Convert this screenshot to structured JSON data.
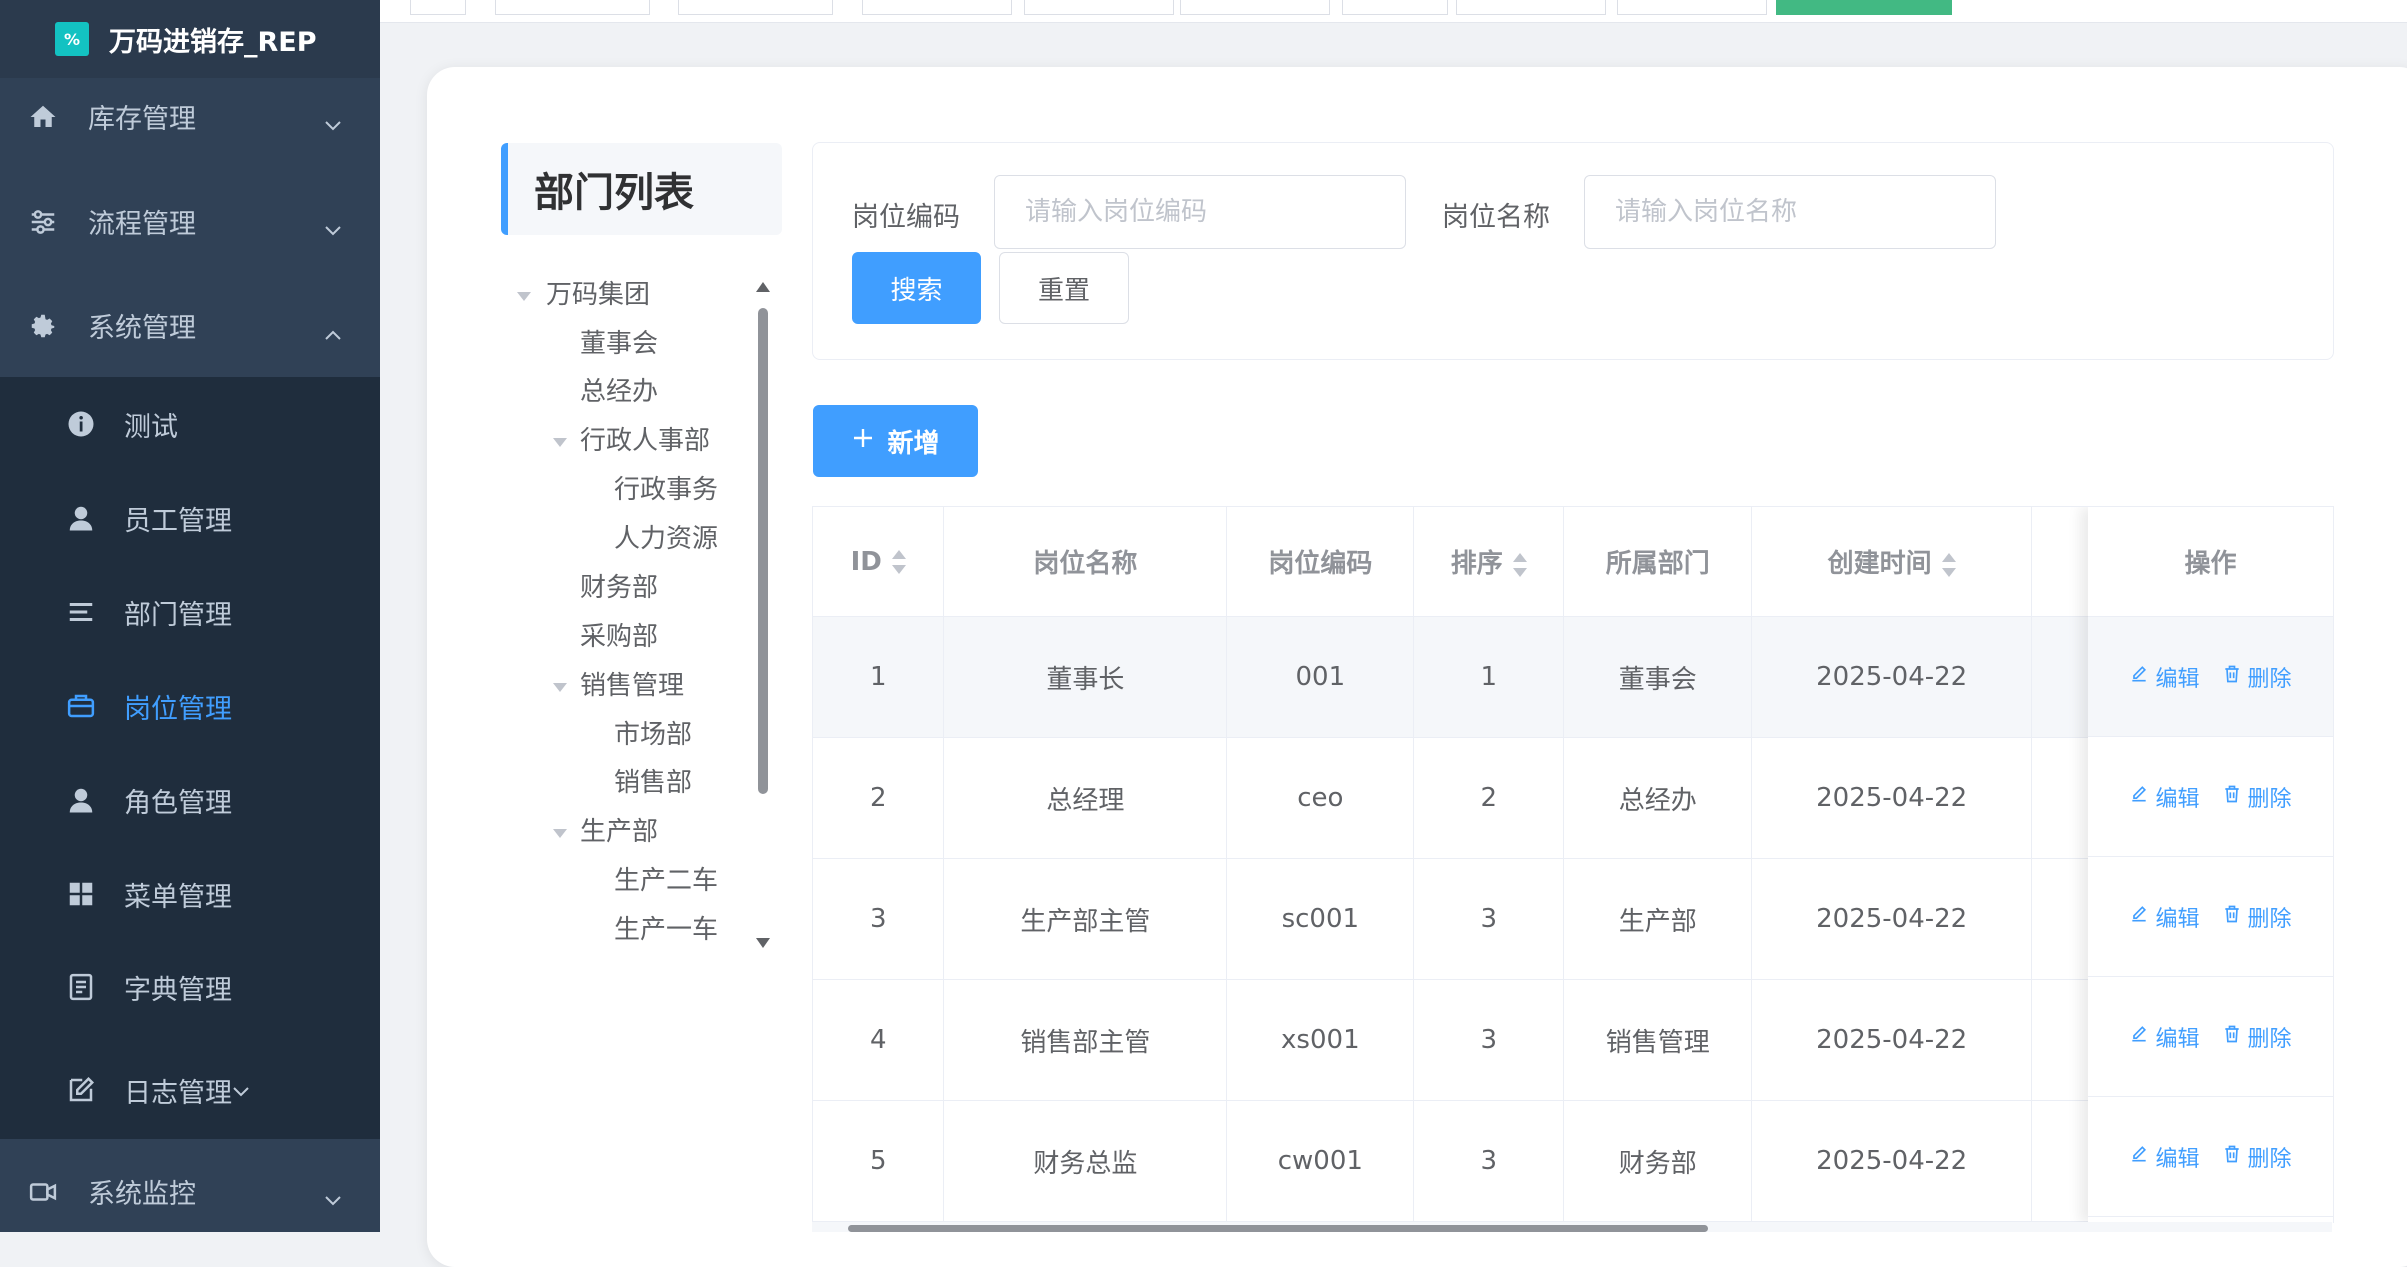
{
  "app": {
    "logo_text": "%",
    "title": "万码进销存_REP"
  },
  "sidebar": {
    "top_menus": [
      {
        "label": "库存管理",
        "icon": "home-icon",
        "expanded": false
      },
      {
        "label": "流程管理",
        "icon": "sliders-icon",
        "expanded": false
      },
      {
        "label": "系统管理",
        "icon": "gear-icon",
        "expanded": true
      }
    ],
    "sub_items": [
      {
        "label": "测试",
        "icon": "info-icon"
      },
      {
        "label": "员工管理",
        "icon": "user-icon"
      },
      {
        "label": "部门管理",
        "icon": "list-icon"
      },
      {
        "label": "岗位管理",
        "icon": "briefcase-icon",
        "active": true
      },
      {
        "label": "角色管理",
        "icon": "user-icon"
      },
      {
        "label": "菜单管理",
        "icon": "grid-icon"
      },
      {
        "label": "字典管理",
        "icon": "document-icon"
      },
      {
        "label": "日志管理",
        "icon": "edit-icon"
      }
    ],
    "bottom_menu": {
      "label": "系统监控",
      "icon": "video-icon"
    }
  },
  "dept_panel": {
    "title": "部门列表",
    "tree": [
      {
        "label": "万码集团",
        "level": 0,
        "expandable": true
      },
      {
        "label": "董事会",
        "level": 1
      },
      {
        "label": "总经办",
        "level": 1
      },
      {
        "label": "行政人事部",
        "level": 1,
        "expandable": true
      },
      {
        "label": "行政事务",
        "level": 2
      },
      {
        "label": "人力资源",
        "level": 2
      },
      {
        "label": "财务部",
        "level": 1
      },
      {
        "label": "采购部",
        "level": 1
      },
      {
        "label": "销售管理",
        "level": 1,
        "expandable": true
      },
      {
        "label": "市场部",
        "level": 2
      },
      {
        "label": "销售部",
        "level": 2
      },
      {
        "label": "生产部",
        "level": 1,
        "expandable": true
      },
      {
        "label": "生产二车",
        "level": 2
      },
      {
        "label": "生产一车",
        "level": 2
      }
    ]
  },
  "search": {
    "code_label": "岗位编码",
    "code_placeholder": "请输入岗位编码",
    "code_value": "",
    "name_label": "岗位名称",
    "name_placeholder": "请输入岗位名称",
    "name_value": "",
    "search_button": "搜索",
    "reset_button": "重置"
  },
  "toolbar": {
    "add_button": "新增"
  },
  "table": {
    "columns": [
      "ID",
      "岗位名称",
      "岗位编码",
      "排序",
      "所属部门",
      "创建时间"
    ],
    "sortable": [
      true,
      false,
      false,
      true,
      false,
      true
    ],
    "actions_header": "操作",
    "edit_label": "编辑",
    "delete_label": "删除",
    "rows": [
      [
        "1",
        "董事长",
        "001",
        "1",
        "董事会",
        "2025-04-22"
      ],
      [
        "2",
        "总经理",
        "ceo",
        "2",
        "总经办",
        "2025-04-22"
      ],
      [
        "3",
        "生产部主管",
        "sc001",
        "3",
        "生产部",
        "2025-04-22"
      ],
      [
        "4",
        "销售部主管",
        "xs001",
        "3",
        "销售管理",
        "2025-04-22"
      ],
      [
        "5",
        "财务总监",
        "cw001",
        "3",
        "财务部",
        "2025-04-22"
      ]
    ],
    "hover_row": 0
  },
  "colors": {
    "sidebar_bg": "#304156",
    "submenu_bg": "#1f2d3d",
    "accent": "#409eff",
    "tag_green": "#42b983"
  }
}
